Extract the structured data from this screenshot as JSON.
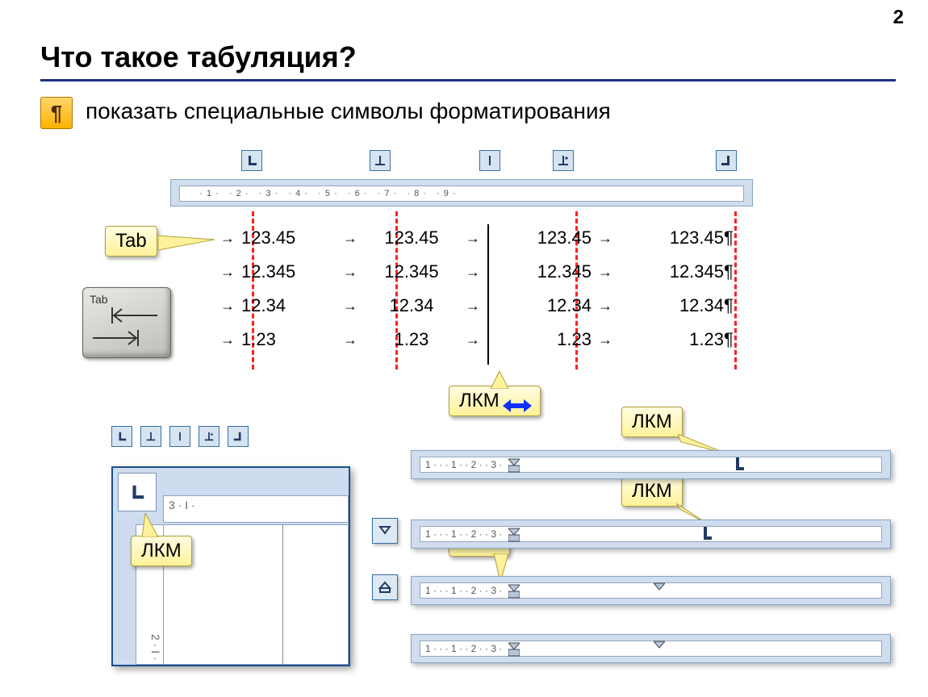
{
  "page_number": "2",
  "title": "Что такое табуляция?",
  "subtitle": "показать специальные символы форматирования",
  "pilcrow_glyph": "¶",
  "tab_label": "Tab",
  "tabkey_label": "Tab",
  "lkm_label": "ЛКМ",
  "ruler_ticks_top": "     · 1 ·   · 2 ·   · 3 ·   · 4 ·   · 5 ·   · 6 ·   · 7 ·   · 8 ·   · 9 ·",
  "corner_ruler_h": "   3  ·  I  ·",
  "corner_ruler_v": " 2 · I ·",
  "tab_stops": [
    "left",
    "center",
    "bar",
    "decimal",
    "right"
  ],
  "data_rows": [
    {
      "c1": "123.45",
      "c2": "123.45",
      "c3": "123.45",
      "c4": "123.45"
    },
    {
      "c1": "12.345",
      "c2": "12.345",
      "c3": "12.345",
      "c4": "12.345"
    },
    {
      "c1": "12.34",
      "c2": "12.34",
      "c3": "12.34",
      "c4": "12.34"
    },
    {
      "c1": "1.23",
      "c2": "1.23",
      "c3": "1.23",
      "c4": "1.23"
    }
  ],
  "bottom_rulers": [
    " 1 ·   ·   · 1 ·   · 2 ·   · 3 ·",
    " 1 ·   ·   · 1 ·   · 2 ·   · 3 ·",
    " 1 ·   ·   · 1 ·   · 2 ·   · 3 ·",
    " 1 ·   ·   · 1 ·   · 2 ·   · 3 ·"
  ]
}
